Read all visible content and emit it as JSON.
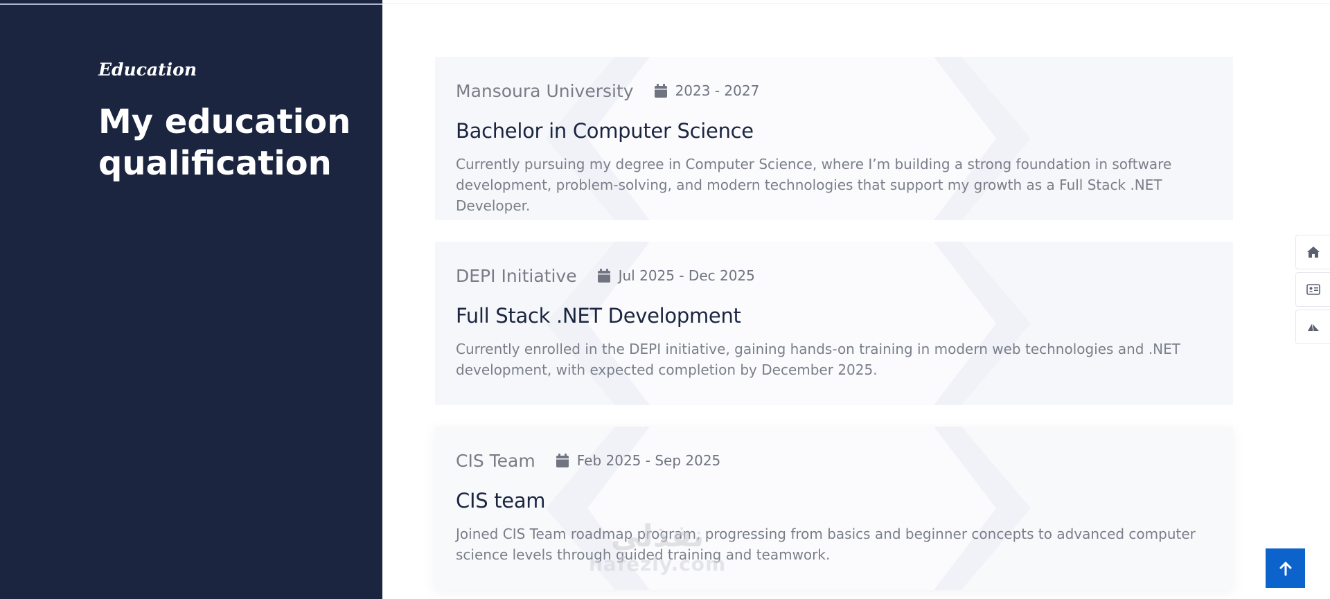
{
  "section": {
    "subtitle": "Education",
    "heading": "My education qualification"
  },
  "education": [
    {
      "org": "Mansoura University",
      "date": "2023 - 2027",
      "title": "Bachelor in Computer Science",
      "description": "Currently pursuing my degree in Computer Science, where I’m building a strong foundation in software development, problem-solving, and modern technologies that support my growth as a Full Stack .NET Developer."
    },
    {
      "org": "DEPI Initiative",
      "date": "Jul 2025 - Dec 2025",
      "title": "Full Stack .NET Development",
      "description": "Currently enrolled in the DEPI initiative, gaining hands-on training in modern web technologies and .NET development, with expected completion by December 2025."
    },
    {
      "org": "CIS Team",
      "date": "Feb 2025 - Sep 2025",
      "title": "CIS team",
      "description": "Joined CIS Team roadmap program, progressing from basics and beginner concepts to advanced computer science levels through guided training and teamwork."
    }
  ],
  "side_nav": {
    "icons": [
      "home-icon",
      "id-card-icon",
      "paper-plane-icon"
    ]
  },
  "back_to_top": {
    "icon": "arrow-up-icon"
  },
  "watermark": {
    "arabic": "نفذلي",
    "latin": "nafezly.com"
  },
  "colors": {
    "panel": "#1b2540",
    "accent": "#0d63cc",
    "card_bg": "#f6f7fa",
    "title": "#1b2540",
    "muted": "#797e89"
  }
}
